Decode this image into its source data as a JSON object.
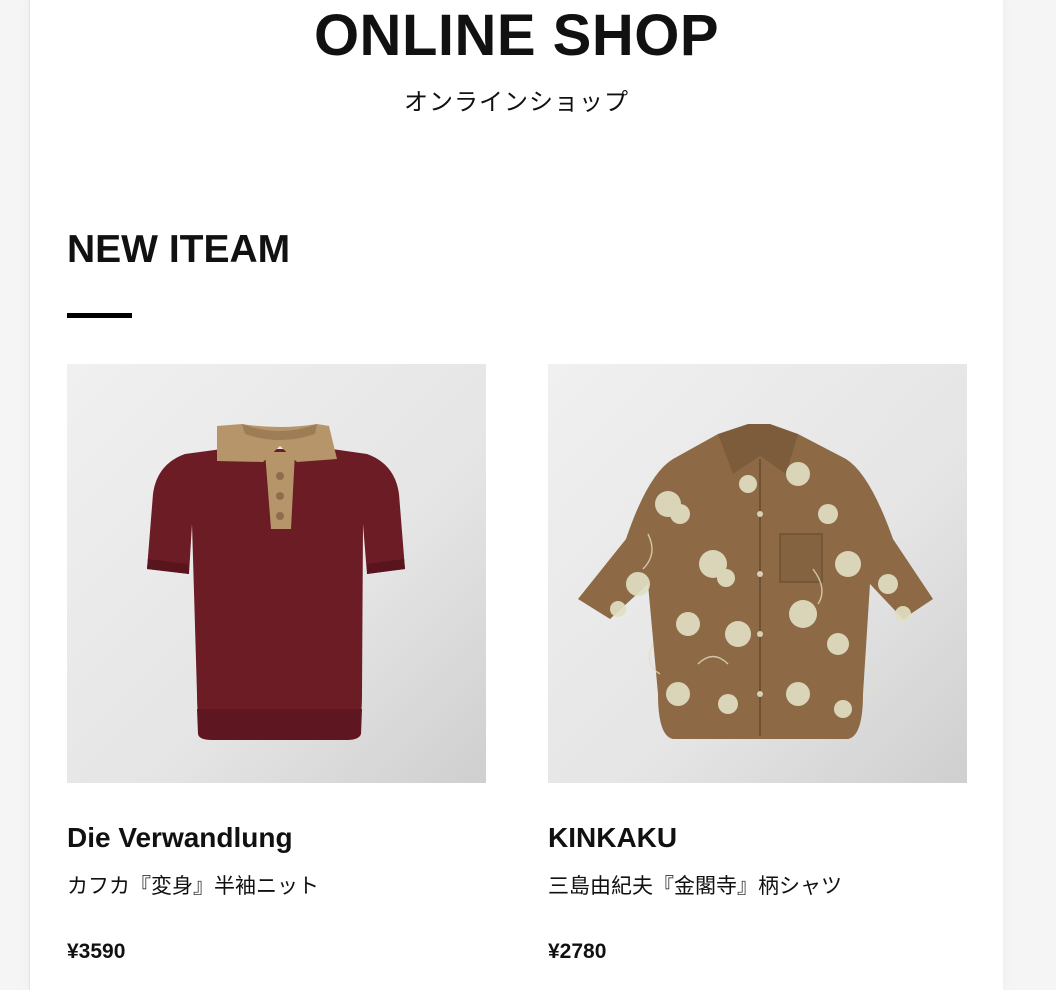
{
  "header": {
    "title": "ONLINE SHOP",
    "subtitle": "オンラインショップ"
  },
  "section": {
    "title": "NEW ITEAM"
  },
  "products": [
    {
      "name": "Die Verwandlung",
      "description": "カフカ『変身』半袖ニット",
      "price": "¥3590",
      "image": "burgundy-knit-polo-with-tan-collar",
      "colors": {
        "body": "#6b1c25",
        "collar": "#b7956a"
      }
    },
    {
      "name": "KINKAKU",
      "description": "三島由紀夫『金閣寺』柄シャツ",
      "price": "¥2780",
      "image": "brown-floral-long-sleeve-shirt",
      "colors": {
        "body": "#8d6a45",
        "print": "#e1dfc2"
      }
    }
  ]
}
